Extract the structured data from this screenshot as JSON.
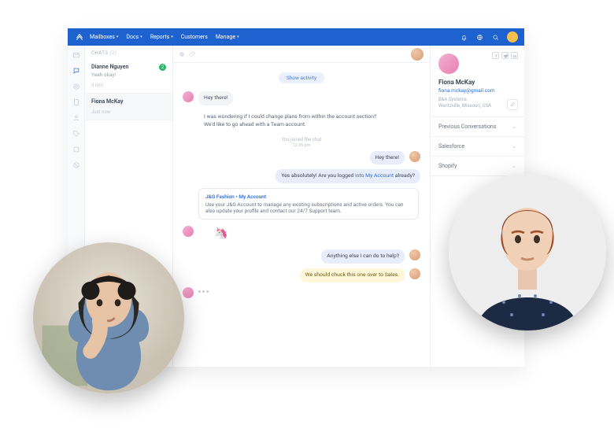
{
  "nav": {
    "items": [
      "Mailboxes",
      "Docs",
      "Reports",
      "Customers",
      "Manage"
    ]
  },
  "chats": {
    "header": "CHATS",
    "count": "(2)",
    "items": [
      {
        "name": "Dianne Nguyen",
        "preview": "Yeah okay!",
        "time": "3 min",
        "badge": "2"
      },
      {
        "name": "Fiona McKay",
        "preview": "",
        "time": "Just now",
        "badge": ""
      }
    ]
  },
  "chat": {
    "show_activity": "Show activity",
    "msgs": {
      "m1": "Hey there!",
      "m2a": "I was wondering if I could change plans from within the account section?",
      "m2b": "We'd like to go ahead with a Team account.",
      "sys": "You joined the chat",
      "systime": "12:26 pm",
      "m3": "Hey there!",
      "m4a": "Yes absolutely! Are you logged ",
      "m4link": "into My Account",
      "m4b": " already?",
      "card_title": "J&G Fashion • My Account",
      "card_body": "Use your J&G Account to manage any existing subscriptions and active orders. You can also update your profile and contact our 24/7 Support team.",
      "m5": "Anything else I can do to help?",
      "m6": "We should chuck this one over to Sales."
    }
  },
  "customer": {
    "name": "Fiona McKay",
    "email": "fiona.mckay@gmail.com",
    "company": "B&A Systems",
    "location": "Wentzville, Missouri, USA",
    "sections": [
      "Previous Conversations",
      "Salesforce",
      "Shopify"
    ]
  }
}
